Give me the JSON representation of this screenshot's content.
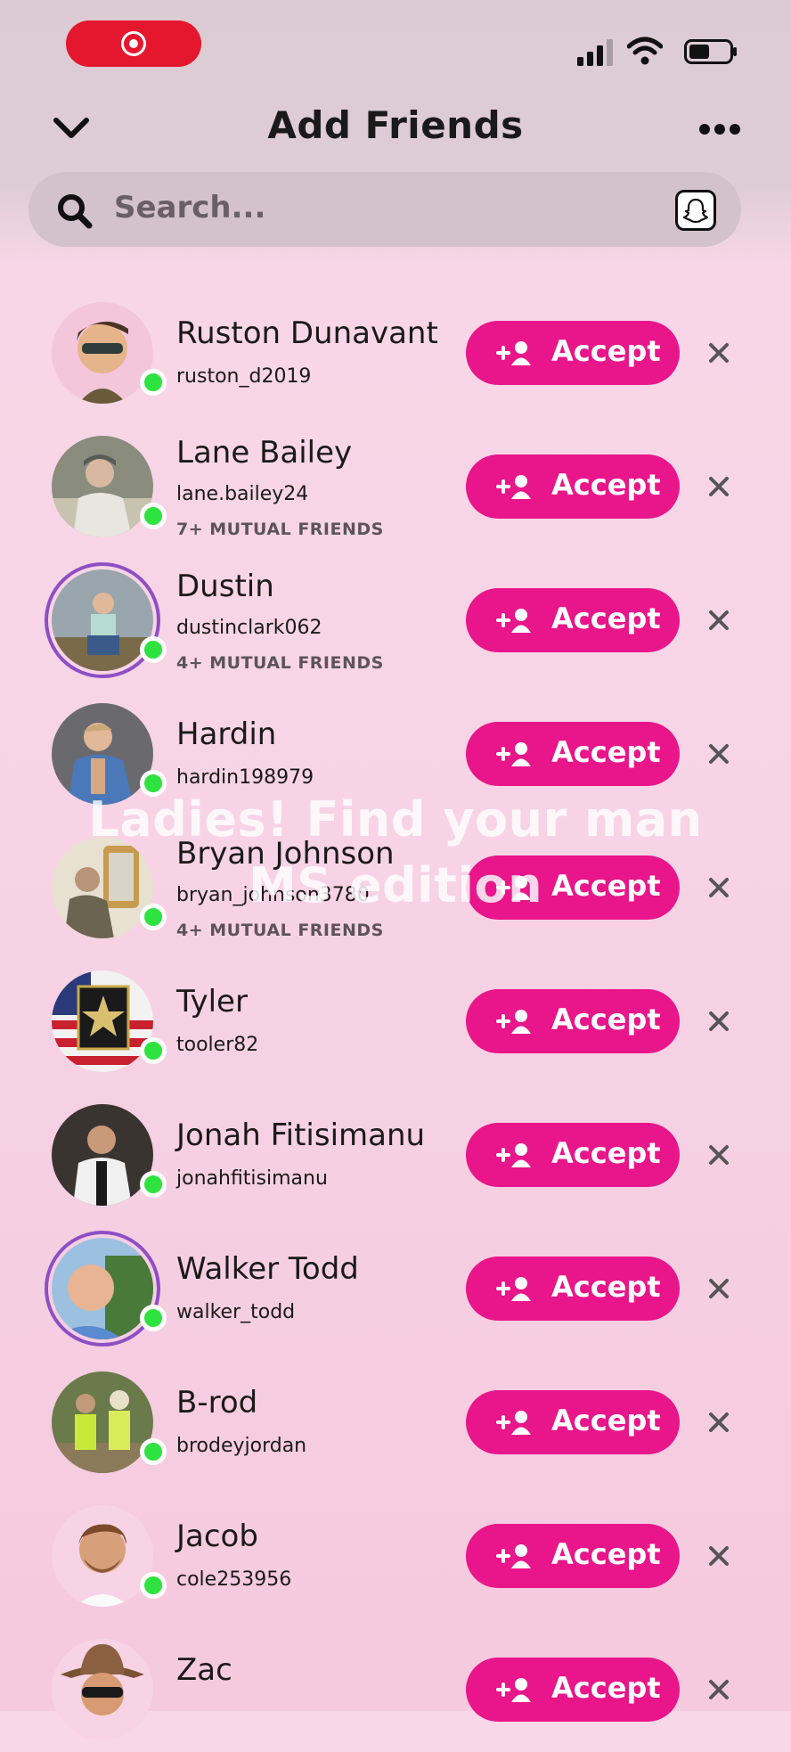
{
  "header": {
    "title": "Add Friends"
  },
  "search": {
    "placeholder": "Search..."
  },
  "accept_label": "Accept",
  "overlay": {
    "line1": "Ladies! Find your man",
    "line2": "MS edition"
  },
  "requests": [
    {
      "name": "Ruston Dunavant",
      "username": "ruston_d2019",
      "mutual": ""
    },
    {
      "name": "Lane Bailey",
      "username": "lane.bailey24",
      "mutual": "7+ MUTUAL FRIENDS"
    },
    {
      "name": "Dustin",
      "username": "dustinclark062",
      "mutual": "4+ MUTUAL FRIENDS"
    },
    {
      "name": "Hardin",
      "username": "hardin198979",
      "mutual": ""
    },
    {
      "name": "Bryan Johnson",
      "username": "bryan_johnson3780",
      "mutual": "4+ MUTUAL FRIENDS"
    },
    {
      "name": "Tyler",
      "username": "tooler82",
      "mutual": ""
    },
    {
      "name": "Jonah Fitisimanu",
      "username": "jonahfitisimanu",
      "mutual": ""
    },
    {
      "name": "Walker Todd",
      "username": "walker_todd",
      "mutual": ""
    },
    {
      "name": "B-rod",
      "username": "brodeyjordan",
      "mutual": ""
    },
    {
      "name": "Jacob",
      "username": "cole253956",
      "mutual": ""
    },
    {
      "name": "Zac",
      "username": "",
      "mutual": ""
    }
  ],
  "colors": {
    "accent": "#e8168a",
    "online": "#2ee33f",
    "story_ring": "#8d4fc4"
  }
}
